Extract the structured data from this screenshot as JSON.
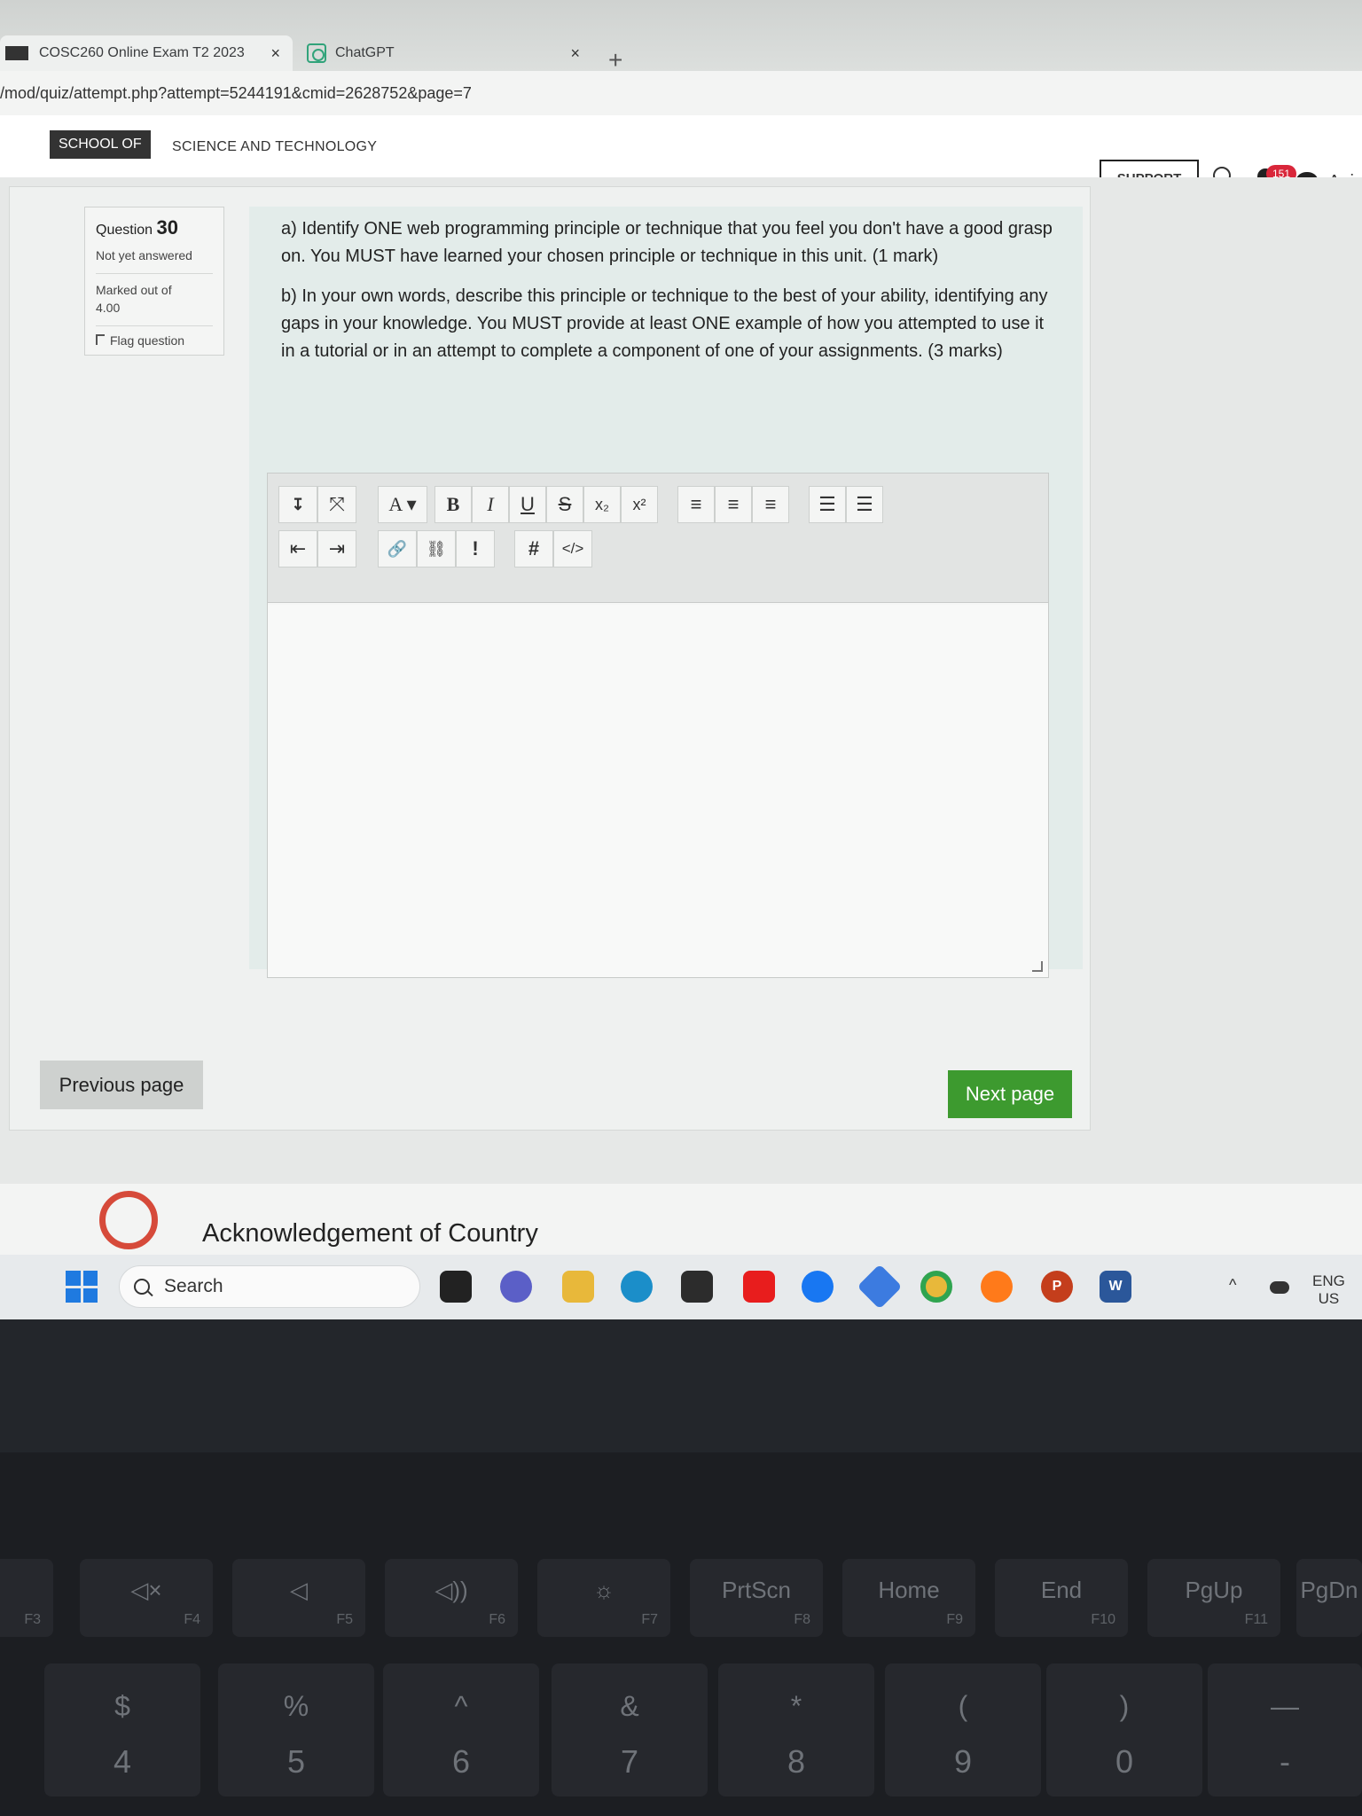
{
  "browser": {
    "tabs": [
      {
        "label": "COSC260 Online Exam T2 2023",
        "close": "×"
      },
      {
        "label": "ChatGPT",
        "close": "×"
      }
    ],
    "new_tab": "+",
    "url": "/mod/quiz/attempt.php?attempt=5244191&cmid=2628752&page=7"
  },
  "header": {
    "school_badge": "SCHOOL OF",
    "school_name": "SCIENCE AND TECHNOLOGY",
    "support_label": "SUPPORT",
    "notification_count": "151",
    "user_name": "Anis"
  },
  "question": {
    "label": "Question",
    "number": "30",
    "state": "Not yet answered",
    "marked_out_of": "Marked out of",
    "marks": "4.00",
    "flag_label": "Flag question",
    "part_a": "a) Identify ONE web programming principle or technique that you feel you don't have a good grasp on. You MUST have learned your chosen principle or technique in this unit. (1 mark)",
    "part_b": "b) In your own words, describe this principle or technique to the best of your ability, identifying any gaps in your knowledge. You MUST provide at least ONE example of how you attempted to use it in a tutorial or in an attempt to complete a component of one of your assignments. (3 marks)"
  },
  "editor": {
    "row1": [
      "↧",
      "⤧",
      "A ▾",
      "B",
      "I",
      "U",
      "S",
      "x₂",
      "x²",
      "≡",
      "≡",
      "≡",
      "☰",
      "☰"
    ],
    "row2": [
      "⇤",
      "⇥",
      "🔗",
      "⛓",
      "!",
      "#",
      "</>"
    ],
    "value": ""
  },
  "navigation": {
    "previous": "Previous page",
    "next": "Next page"
  },
  "footer": {
    "acknowledgement": "Acknowledgement of Country"
  },
  "taskbar": {
    "search_placeholder": "Search",
    "lang_line1": "ENG",
    "lang_line2": "US"
  },
  "keyboard": {
    "frow": [
      {
        "main": "",
        "sub": "F3"
      },
      {
        "main": "◁×",
        "sub": "F4"
      },
      {
        "main": "◁",
        "sub": "F5"
      },
      {
        "main": "◁))",
        "sub": "F6"
      },
      {
        "main": "☼",
        "sub": "F7"
      },
      {
        "main": "PrtScn",
        "sub": "F8"
      },
      {
        "main": "Home",
        "sub": "F9"
      },
      {
        "main": "End",
        "sub": "F10"
      },
      {
        "main": "PgUp",
        "sub": "F11"
      },
      {
        "main": "PgDn",
        "sub": ""
      }
    ],
    "numrow": [
      {
        "top": "$",
        "main": "4"
      },
      {
        "top": "%",
        "main": "5"
      },
      {
        "top": "^",
        "main": "6"
      },
      {
        "top": "&",
        "main": "7"
      },
      {
        "top": "*",
        "main": "8"
      },
      {
        "top": "(",
        "main": "9"
      },
      {
        "top": ")",
        "main": "0"
      },
      {
        "top": "—",
        "main": "-"
      }
    ]
  },
  "colors": {
    "next_button": "#3d9a2f",
    "badge": "#d9263a",
    "ack_logo": "#d64a3a"
  }
}
